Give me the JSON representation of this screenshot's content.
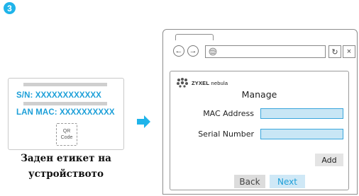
{
  "step_number": "3",
  "device_label": {
    "serial_text": "S/N: XXXXXXXXXXXX",
    "mac_text": "LAN MAC: XXXXXXXXXX",
    "qr_text": "QR Code",
    "caption": "Заден етикет на устройството"
  },
  "browser": {
    "logo_brand": "ZYXEL",
    "logo_product": "nebula",
    "title": "Manage",
    "mac_label": "MAC Address",
    "serial_label": "Serial Number",
    "add_label": "Add",
    "back_label": "Back",
    "next_label": "Next",
    "reload_icon": "↻",
    "close_icon": "×"
  },
  "colors": {
    "accent": "#1fb4ea",
    "label_text": "#1c9fd8",
    "field_fill": "#c8e6f5",
    "field_border": "#3aa6dc"
  }
}
